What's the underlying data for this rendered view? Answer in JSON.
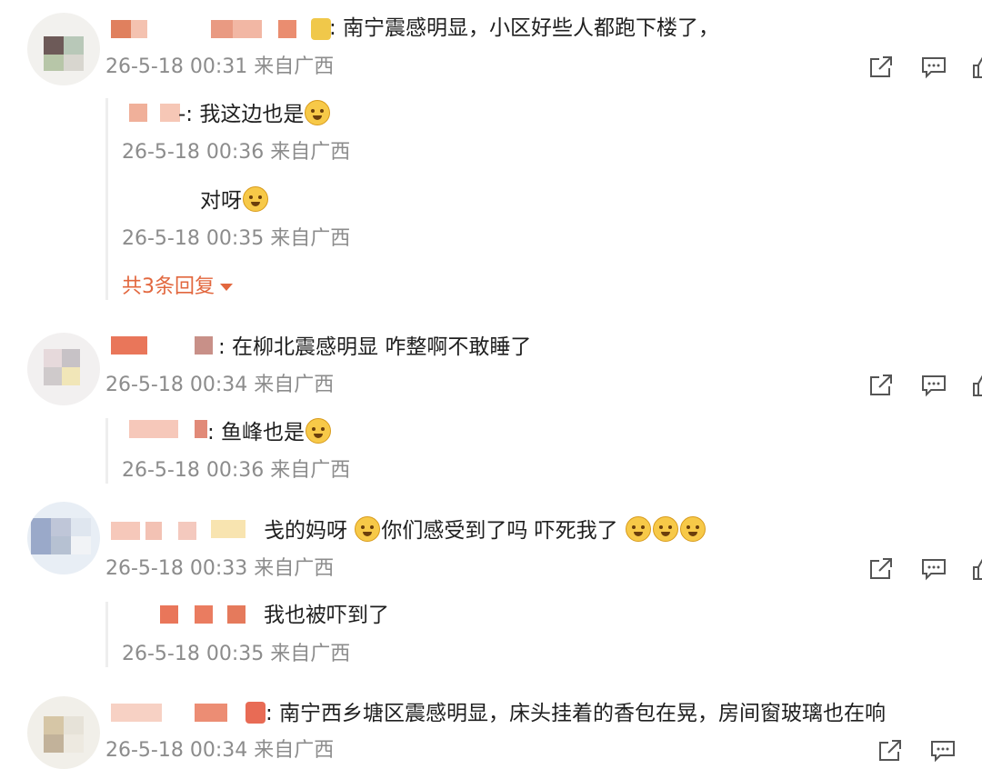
{
  "comments": [
    {
      "username_visible": "",
      "text": ": 南宁震感明显，小区好些人都跑下楼了，",
      "meta": "26-5-18 00:31 来自广西",
      "replies": [
        {
          "text": "-: 我这边也是",
          "meta": "26-5-18 00:36 来自广西"
        },
        {
          "text": "对呀",
          "meta": "26-5-18 00:35 来自广西"
        }
      ],
      "more_replies": "共3条回复"
    },
    {
      "text": ": 在柳北震感明显 咋整啊不敢睡了",
      "meta": "26-5-18 00:34 来自广西",
      "replies": [
        {
          "text": ": 鱼峰也是",
          "meta": "26-5-18 00:36 来自广西"
        }
      ]
    },
    {
      "text_a": "戋的妈呀",
      "text_b": "你们感受到了吗 吓死我了",
      "meta": "26-5-18 00:33 来自广西",
      "replies": [
        {
          "text": "我也被吓到了",
          "meta": "26-5-18 00:35 来自广西"
        }
      ]
    },
    {
      "text": ": 南宁西乡塘区震感明显，床头挂着的香包在晃，房间窗玻璃也在响",
      "meta": "26-5-18 00:34 来自广西"
    }
  ],
  "icons": [
    "share-icon",
    "comment-icon",
    "like-icon"
  ],
  "colors": {
    "accent": "#e2673e",
    "meta": "#8c8c8c",
    "text": "#1f1f1f"
  }
}
